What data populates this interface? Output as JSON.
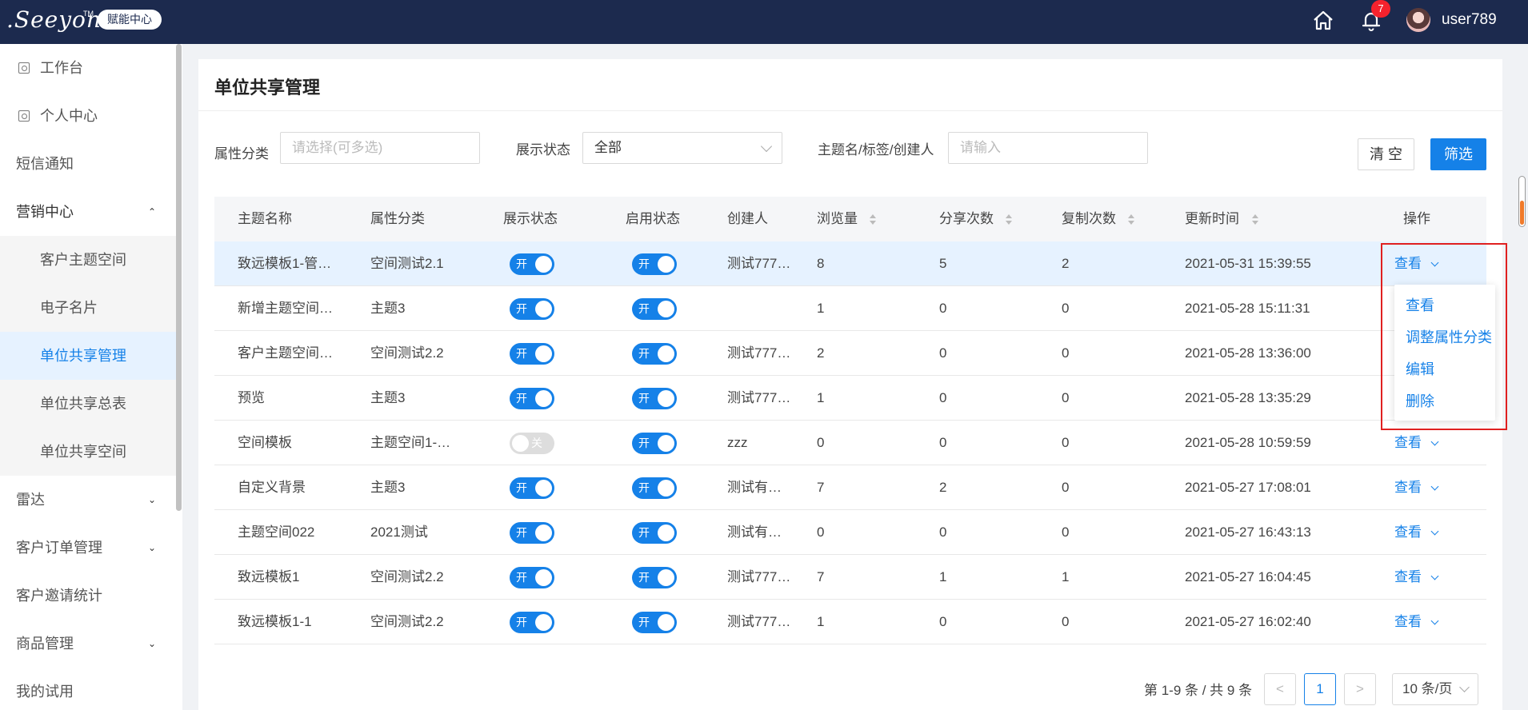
{
  "topbar": {
    "logo": ".Seeyon",
    "logo_tm": "TM",
    "badge": "赋能中心",
    "notification_count": "7",
    "username": "user789"
  },
  "sidebar": {
    "items": [
      {
        "label": "工作台"
      },
      {
        "label": "个人中心"
      },
      {
        "label": "短信通知"
      },
      {
        "label": "营销中心"
      },
      {
        "label": "客户主题空间"
      },
      {
        "label": "电子名片"
      },
      {
        "label": "单位共享管理"
      },
      {
        "label": "单位共享总表"
      },
      {
        "label": "单位共享空间"
      },
      {
        "label": "雷达"
      },
      {
        "label": "客户订单管理"
      },
      {
        "label": "客户邀请统计"
      },
      {
        "label": "商品管理"
      },
      {
        "label": "我的试用"
      }
    ]
  },
  "page": {
    "title": "单位共享管理"
  },
  "filters": {
    "category_label": "属性分类",
    "category_placeholder": "请选择(可多选)",
    "display_label": "展示状态",
    "display_value": "全部",
    "keyword_label": "主题名/标签/创建人",
    "keyword_placeholder": "请输入",
    "clear_label": "清 空",
    "filter_label": "筛选"
  },
  "table": {
    "headers": [
      "主题名称",
      "属性分类",
      "展示状态",
      "启用状态",
      "创建人",
      "浏览量",
      "分享次数",
      "复制次数",
      "更新时间",
      "操作"
    ],
    "switch_on": "开",
    "switch_off": "关",
    "rows": [
      {
        "name": "致远模板1-管…",
        "category": "空间测试2.1",
        "display": "on",
        "enabled": "on",
        "creator": "测试777…",
        "views": "8",
        "shares": "5",
        "copies": "2",
        "updated": "2021-05-31 15:39:55",
        "op": "查看"
      },
      {
        "name": "新增主题空间…",
        "category": "主题3",
        "display": "on",
        "enabled": "on",
        "creator": "",
        "views": "1",
        "shares": "0",
        "copies": "0",
        "updated": "2021-05-28 15:11:31",
        "op": ""
      },
      {
        "name": "客户主题空间…",
        "category": "空间测试2.2",
        "display": "on",
        "enabled": "on",
        "creator": "测试777…",
        "views": "2",
        "shares": "0",
        "copies": "0",
        "updated": "2021-05-28 13:36:00",
        "op": ""
      },
      {
        "name": "预览",
        "category": "主题3",
        "display": "on",
        "enabled": "on",
        "creator": "测试777…",
        "views": "1",
        "shares": "0",
        "copies": "0",
        "updated": "2021-05-28 13:35:29",
        "op": ""
      },
      {
        "name": "空间模板",
        "category": "主题空间1-…",
        "display": "off",
        "enabled": "on",
        "creator": "zzz",
        "views": "0",
        "shares": "0",
        "copies": "0",
        "updated": "2021-05-28 10:59:59",
        "op": "查看"
      },
      {
        "name": "自定义背景",
        "category": "主题3",
        "display": "on",
        "enabled": "on",
        "creator": "测试有…",
        "views": "7",
        "shares": "2",
        "copies": "0",
        "updated": "2021-05-27 17:08:01",
        "op": "查看"
      },
      {
        "name": "主题空间022",
        "category": "2021测试",
        "display": "on",
        "enabled": "on",
        "creator": "测试有…",
        "views": "0",
        "shares": "0",
        "copies": "0",
        "updated": "2021-05-27 16:43:13",
        "op": "查看"
      },
      {
        "name": "致远模板1",
        "category": "空间测试2.2",
        "display": "on",
        "enabled": "on",
        "creator": "测试777…",
        "views": "7",
        "shares": "1",
        "copies": "1",
        "updated": "2021-05-27 16:04:45",
        "op": "查看"
      },
      {
        "name": "致远模板1-1",
        "category": "空间测试2.2",
        "display": "on",
        "enabled": "on",
        "creator": "测试777…",
        "views": "1",
        "shares": "0",
        "copies": "0",
        "updated": "2021-05-27 16:02:40",
        "op": "查看"
      }
    ]
  },
  "dropdown": {
    "items": [
      "查看",
      "调整属性分类",
      "编辑",
      "删除"
    ]
  },
  "pagination": {
    "summary": "第 1-9 条 / 共 9 条",
    "prev": "<",
    "current": "1",
    "next": ">",
    "page_size": "10 条/页"
  },
  "colors": {
    "primary": "#1581e8",
    "topbar": "#1c2a4e",
    "highlight_row": "#e6f2ff",
    "annotation": "#e02020"
  }
}
